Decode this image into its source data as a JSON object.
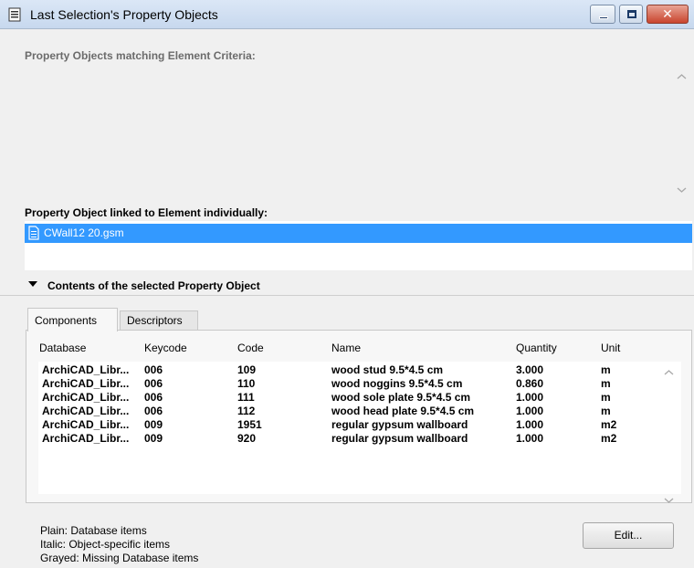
{
  "window": {
    "title": "Last Selection's Property Objects",
    "close_glyph": "✕",
    "icons": [
      "list-document-icon",
      "minimize-icon",
      "maximize-icon",
      "close-icon"
    ]
  },
  "matching": {
    "label": "Property Objects matching Element Criteria:",
    "items": []
  },
  "linked": {
    "label": "Property Object linked to Element individually:",
    "selected_item": "CWall12 20.gsm",
    "selected_icon": "file-icon",
    "selection_color": "#3399ff"
  },
  "contents": {
    "label": "Contents of the selected Property Object",
    "expanded": true
  },
  "tabs": {
    "components": "Components",
    "descriptors": "Descriptors",
    "active": "Components"
  },
  "table": {
    "columns": [
      "Database",
      "Keycode",
      "Code",
      "Name",
      "Quantity",
      "Unit"
    ],
    "rows": [
      [
        "ArchiCAD_Libr...",
        "006",
        "109",
        "wood stud 9.5*4.5 cm",
        "3.000",
        "m"
      ],
      [
        "ArchiCAD_Libr...",
        "006",
        "110",
        "wood noggins 9.5*4.5 cm",
        "0.860",
        "m"
      ],
      [
        "ArchiCAD_Libr...",
        "006",
        "111",
        "wood sole plate 9.5*4.5 cm",
        "1.000",
        "m"
      ],
      [
        "ArchiCAD_Libr...",
        "006",
        "112",
        "wood head plate 9.5*4.5 cm",
        "1.000",
        "m"
      ],
      [
        "ArchiCAD_Libr...",
        "009",
        "1951",
        "regular gypsum wallboard",
        "1.000",
        "m2"
      ],
      [
        "ArchiCAD_Libr...",
        "009",
        "920",
        "regular gypsum wallboard",
        "1.000",
        "m2"
      ]
    ]
  },
  "legend": {
    "plain": "Plain: Database items",
    "italic": "Italic: Object-specific items",
    "grayed": "Grayed: Missing Database items"
  },
  "edit_button": "Edit..."
}
